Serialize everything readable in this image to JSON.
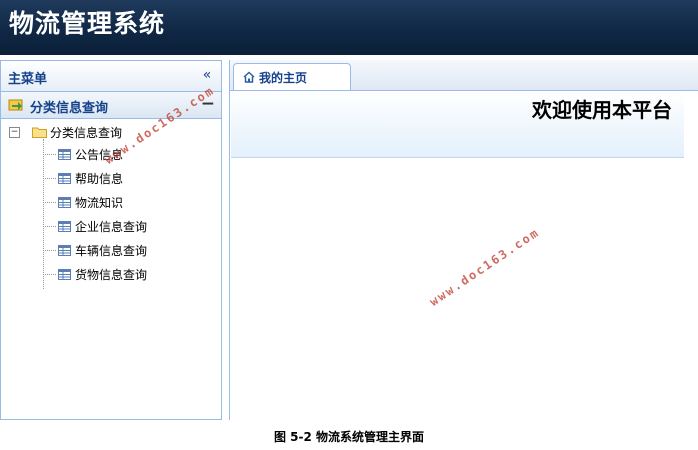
{
  "app": {
    "title": "物流管理系统"
  },
  "sidebar": {
    "title": "主菜单",
    "collapse_icon": "double-chevron-left-icon",
    "section": {
      "title": "分类信息查询",
      "collapse_icon": "minus-icon"
    },
    "tree": {
      "root": {
        "label": "分类信息查询",
        "expander": "⊟"
      },
      "items": [
        {
          "label": "公告信息"
        },
        {
          "label": "帮助信息"
        },
        {
          "label": "物流知识"
        },
        {
          "label": "企业信息查询"
        },
        {
          "label": "车辆信息查询"
        },
        {
          "label": "货物信息查询"
        }
      ]
    }
  },
  "main": {
    "tabs": [
      {
        "label": "我的主页",
        "icon": "home-icon"
      }
    ],
    "welcome": "欢迎使用本平台"
  },
  "caption": "图 5-2 物流系统管理主界面",
  "watermarks": [
    "www.doc163.com",
    "www.doc163.com"
  ],
  "colors": {
    "header": "#0f2744",
    "border": "#99bbe8",
    "accent": "#15428b",
    "watermark": "#c0392b"
  }
}
